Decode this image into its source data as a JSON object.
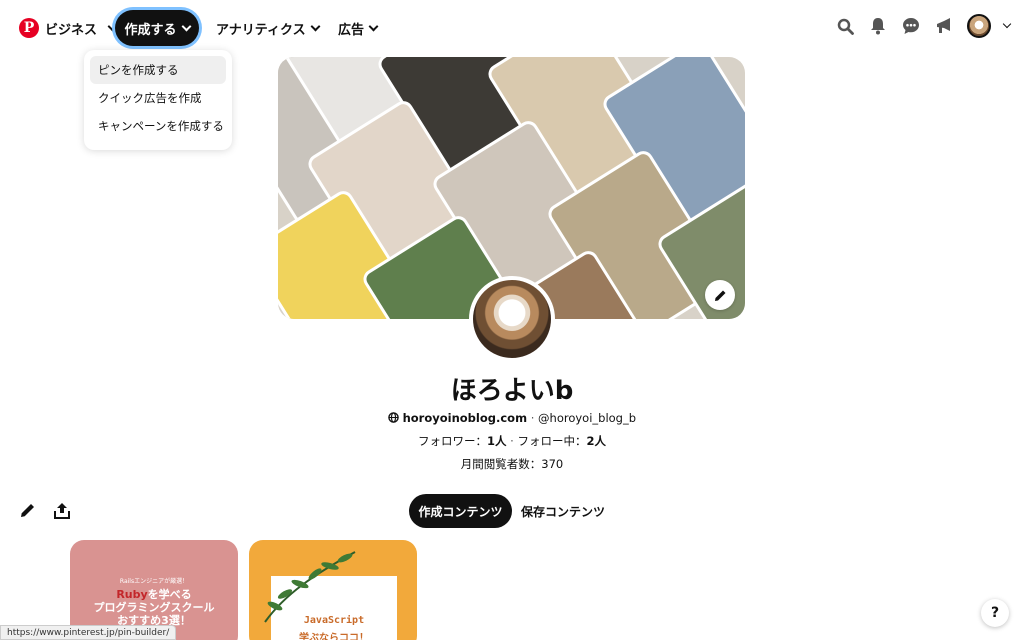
{
  "nav": {
    "brand_label": "ビジネス",
    "create_label": "作成する",
    "analytics_label": "アナリティクス",
    "ads_label": "広告",
    "icons": [
      "search-icon",
      "bell-icon",
      "message-icon",
      "megaphone-icon",
      "avatar",
      "chevron-down-icon"
    ]
  },
  "create_menu": {
    "items": [
      {
        "label": "ピンを作成する"
      },
      {
        "label": "クイック広告を作成"
      },
      {
        "label": "キャンペーンを作成する"
      }
    ]
  },
  "profile": {
    "name": "ほろよいb",
    "website": "horoyoinoblog.com",
    "separator": "·",
    "handle": "@horoyoi_blog_b",
    "followers_label": "フォロワー：",
    "followers_value": "1人",
    "following_label": "フォロー中：",
    "following_value": "2人",
    "monthly_views_label": "月間閲覧者数：",
    "monthly_views_value": "370"
  },
  "tabs": {
    "created": "作成コンテンツ",
    "saved": "保存コンテンツ"
  },
  "pins": [
    {
      "subtitle": "Railsエンジニアが厳選！",
      "title_highlight": "Ruby",
      "title_rest": "を学べる",
      "title_line2": "プログラミングスクール",
      "title_line3": "おすすめ3選！"
    },
    {
      "title_line1": "JavaScript",
      "title_line2": "学ぶならココ！"
    }
  ],
  "status_bar": {
    "url": "https://www.pinterest.jp/pin-builder/"
  },
  "help": {
    "label": "?"
  },
  "colors": {
    "brand_red": "#e60023",
    "focus_ring": "#7fc1ff",
    "dark": "#111111"
  }
}
